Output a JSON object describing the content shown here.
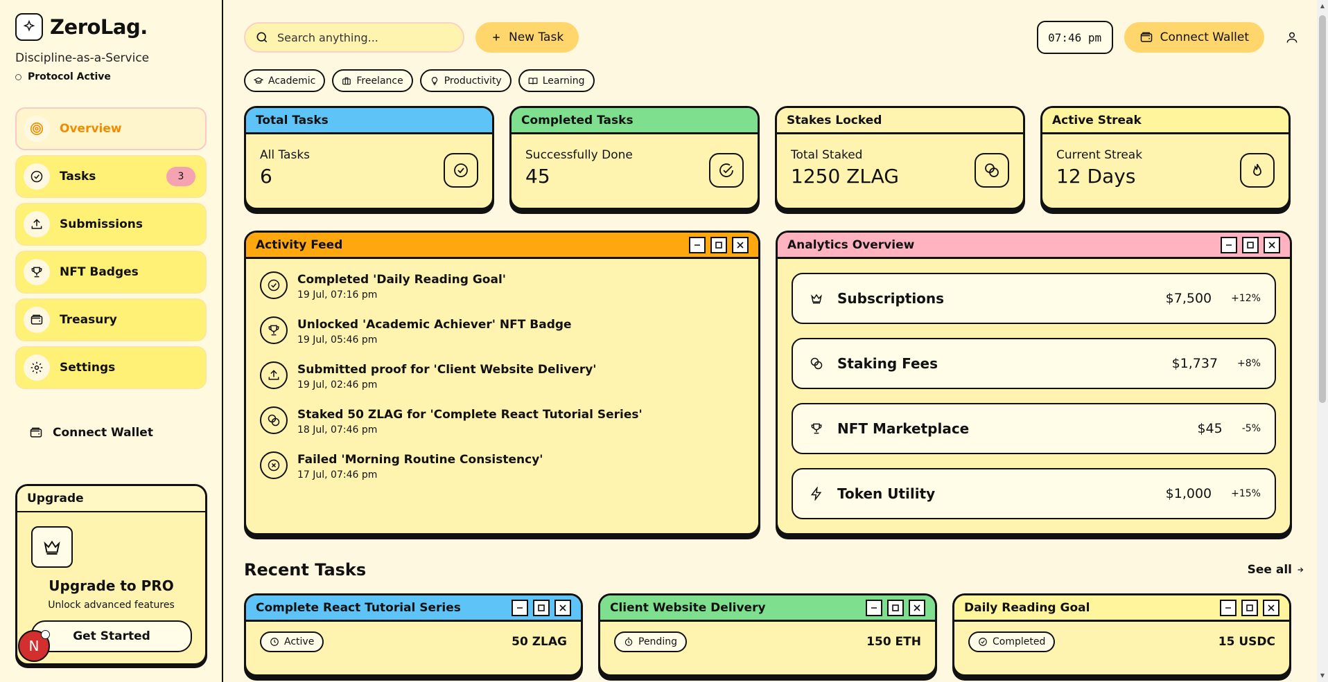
{
  "brand": {
    "name": "ZeroLag.",
    "tagline": "Discipline-as-a-Service",
    "protocol_status": "Protocol Active"
  },
  "sidebar": {
    "items": [
      {
        "label": "Overview",
        "icon": "target-icon",
        "active": true
      },
      {
        "label": "Tasks",
        "icon": "check-circle-icon",
        "badge": "3"
      },
      {
        "label": "Submissions",
        "icon": "upload-icon"
      },
      {
        "label": "NFT Badges",
        "icon": "trophy-icon"
      },
      {
        "label": "Treasury",
        "icon": "wallet-icon"
      },
      {
        "label": "Settings",
        "icon": "gear-icon"
      }
    ],
    "connect_wallet": "Connect Wallet",
    "upgrade": {
      "header": "Upgrade",
      "title": "Upgrade to PRO",
      "subtitle": "Unlock advanced features",
      "button": "Get Started"
    },
    "avatar_letter": "N"
  },
  "topbar": {
    "search_placeholder": "Search anything...",
    "new_task": "New Task",
    "clock": "07:46 pm",
    "connect_wallet": "Connect Wallet"
  },
  "chips": [
    {
      "label": "Academic",
      "icon": "graduation-cap-icon"
    },
    {
      "label": "Freelance",
      "icon": "briefcase-icon"
    },
    {
      "label": "Productivity",
      "icon": "lightbulb-icon"
    },
    {
      "label": "Learning",
      "icon": "book-icon"
    }
  ],
  "stats": [
    {
      "title": "Total Tasks",
      "label": "All Tasks",
      "value": "6",
      "color": "#5ec3f7",
      "icon": "check-circle-icon"
    },
    {
      "title": "Completed Tasks",
      "label": "Successfully Done",
      "value": "45",
      "color": "#7ee08e",
      "icon": "check-badge-icon"
    },
    {
      "title": "Stakes Locked",
      "label": "Total Staked",
      "value": "1250 ZLAG",
      "color": "#fff3b0",
      "icon": "coins-icon"
    },
    {
      "title": "Active Streak",
      "label": "Current Streak",
      "value": "12 Days",
      "color": "#fff59d",
      "icon": "flame-icon"
    }
  ],
  "activity": {
    "title": "Activity Feed",
    "color": "#ffa70f",
    "items": [
      {
        "text": "Completed 'Daily Reading Goal'",
        "time": "19 Jul, 07:16 pm",
        "icon": "check-circle-icon"
      },
      {
        "text": "Unlocked 'Academic Achiever' NFT Badge",
        "time": "19 Jul, 05:46 pm",
        "icon": "trophy-icon"
      },
      {
        "text": "Submitted proof for 'Client Website Delivery'",
        "time": "19 Jul, 02:46 pm",
        "icon": "upload-icon"
      },
      {
        "text": "Staked 50 ZLAG for 'Complete React Tutorial Series'",
        "time": "18 Jul, 07:46 pm",
        "icon": "coins-icon"
      },
      {
        "text": "Failed 'Morning Routine Consistency'",
        "time": "17 Jul, 07:46 pm",
        "icon": "x-circle-icon"
      }
    ]
  },
  "analytics": {
    "title": "Analytics Overview",
    "color": "#ffb3c1",
    "rows": [
      {
        "name": "Subscriptions",
        "amount": "$7,500",
        "change": "+12%",
        "icon": "crown-icon"
      },
      {
        "name": "Staking Fees",
        "amount": "$1,737",
        "change": "+8%",
        "icon": "coins-icon"
      },
      {
        "name": "NFT Marketplace",
        "amount": "$45",
        "change": "-5%",
        "icon": "trophy-icon"
      },
      {
        "name": "Token Utility",
        "amount": "$1,000",
        "change": "+15%",
        "icon": "zap-icon"
      }
    ]
  },
  "recent": {
    "title": "Recent Tasks",
    "see_all": "See all",
    "tasks": [
      {
        "title": "Complete React Tutorial Series",
        "status": "Active",
        "stake": "50 ZLAG",
        "color": "#5ec3f7",
        "icon": "clock-icon"
      },
      {
        "title": "Client Website Delivery",
        "status": "Pending",
        "stake": "150 ETH",
        "color": "#7ee08e",
        "icon": "timer-icon"
      },
      {
        "title": "Daily Reading Goal",
        "status": "Completed",
        "stake": "15 USDC",
        "color": "#fff59d",
        "icon": "check-circle-icon"
      }
    ]
  }
}
